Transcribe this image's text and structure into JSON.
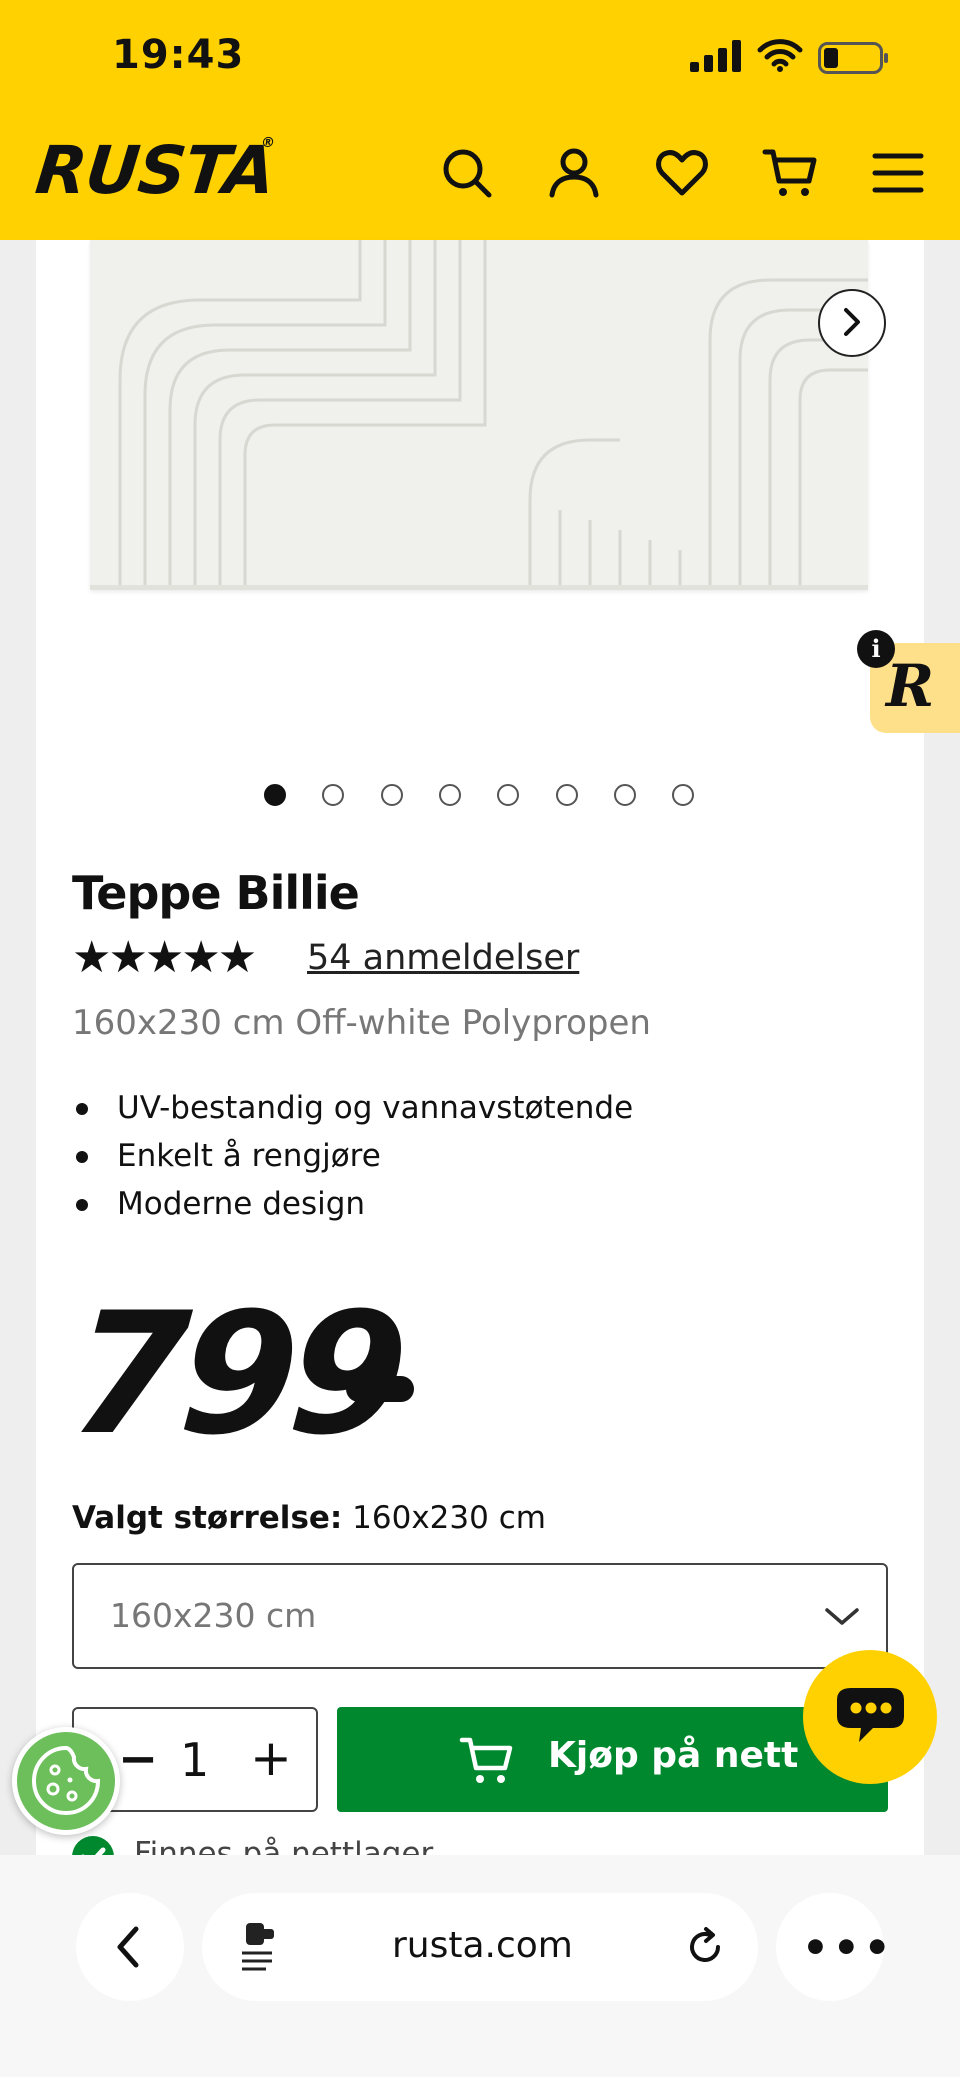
{
  "status_bar": {
    "time": "19:43"
  },
  "header": {
    "logo": "RUSTA",
    "logo_reg": "®",
    "icons": [
      "search-icon",
      "account-icon",
      "heart-icon",
      "cart-icon",
      "menu-icon"
    ]
  },
  "gallery": {
    "slide_count": 8,
    "active_index": 0
  },
  "product": {
    "title": "Teppe Billie",
    "rating_stars": "★★★★★",
    "review_count": "54 anmeldelser",
    "subtitle": "160x230 cm Off-white Polypropen",
    "features": [
      "UV-bestandig og vannavstøtende",
      "Enkelt å rengjøre",
      "Moderne design"
    ],
    "price": "799"
  },
  "size": {
    "label": "Valgt størrelse:",
    "value": "160x230 cm",
    "selected": "160x230 cm"
  },
  "purchase": {
    "qty_minus": "−",
    "quantity": "1",
    "qty_plus": "+",
    "buy_label": "Kjøp på nett",
    "stock_text": "Finnes på nettlager"
  },
  "browser": {
    "url": "rusta.com",
    "more": "•••"
  },
  "colors": {
    "brand_yellow": "#FFD100",
    "buy_green": "#00882F",
    "cookie_green": "#6DBF5B"
  }
}
